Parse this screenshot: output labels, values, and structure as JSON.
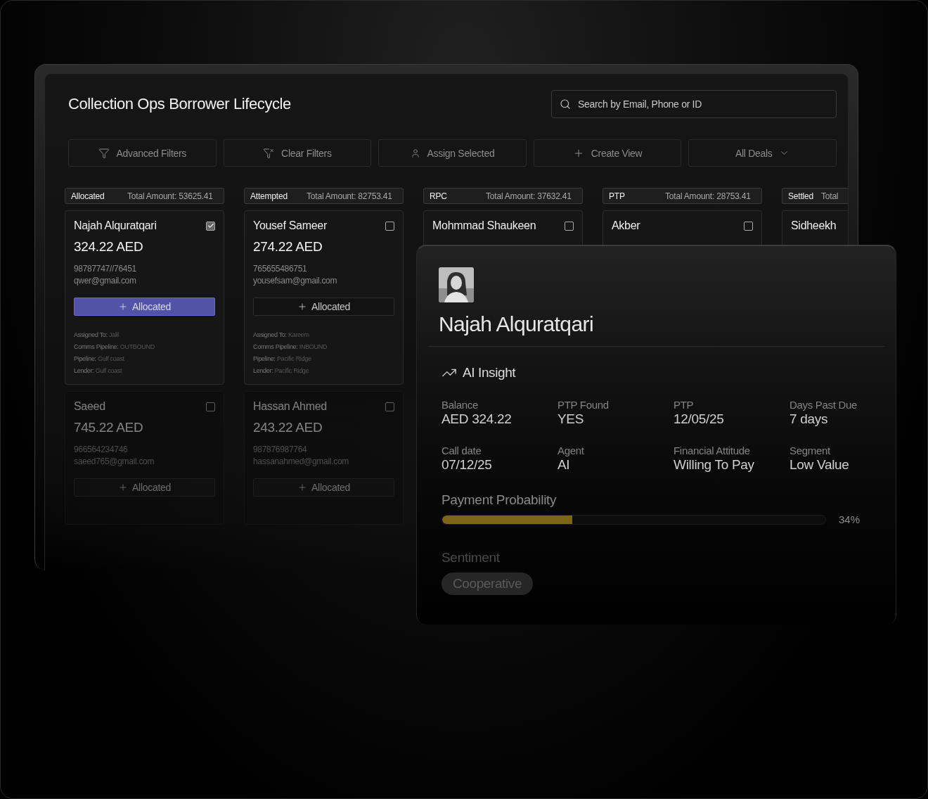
{
  "title": "Collection Ops Borrower Lifecycle",
  "search": {
    "placeholder": "Search by Email, Phone or ID"
  },
  "toolbar": [
    {
      "kind": "filter",
      "label": "Advanced Filters"
    },
    {
      "kind": "clear",
      "label": "Clear Filters"
    },
    {
      "kind": "user",
      "label": "Assign Selected"
    },
    {
      "kind": "plus",
      "label": "Create View"
    },
    {
      "kind": "dropdown",
      "label": "All Deals"
    }
  ],
  "columns": [
    {
      "status": "Allocated",
      "total": "Total Amount: 53625.41",
      "cards": [
        {
          "name": "Najah Alquratqari",
          "amount": "324.22 AED",
          "phone": "98787747//76451",
          "email": "qwer@gmail.com",
          "checked": true,
          "dimmed": false,
          "button": {
            "label": "Allocated",
            "selected": true
          },
          "details": [
            {
              "label": "Assigned To:",
              "value": "Jalil"
            },
            {
              "label": "Comms Pipeline:",
              "value": "OUTBOUND"
            },
            {
              "label": "Pipeline:",
              "value": "Gulf coast"
            },
            {
              "label": "Lender:",
              "value": "Gulf coast"
            }
          ]
        },
        {
          "name": "Saeed",
          "amount": "745.22 AED",
          "phone": "966564234746",
          "email": "saeed765@gmail.com",
          "checked": false,
          "dimmed": true,
          "button": {
            "label": "Allocated",
            "selected": false
          }
        }
      ]
    },
    {
      "status": "Attempted",
      "total": "Total Amount: 82753.41",
      "cards": [
        {
          "name": "Yousef Sameer",
          "amount": "274.22 AED",
          "phone": "765655486751",
          "email": "yousefsam@gmail.com",
          "checked": false,
          "dimmed": false,
          "button": {
            "label": "Allocated",
            "selected": false
          },
          "details": [
            {
              "label": "Assigned To:",
              "value": "Kareem"
            },
            {
              "label": "Comms Pipeline:",
              "value": "INBOUND"
            },
            {
              "label": "Pipeline:",
              "value": "Pacific Ridge"
            },
            {
              "label": "Lender:",
              "value": "Pacific Ridge"
            }
          ]
        },
        {
          "name": "Hassan Ahmed",
          "amount": "243.22 AED",
          "phone": "987876987764",
          "email": "hassanahmed@gmail.com",
          "checked": false,
          "dimmed": true,
          "button": {
            "label": "Allocated",
            "selected": false
          }
        }
      ]
    },
    {
      "status": "RPC",
      "total": "Total Amount: 37632.41",
      "cards": [
        {
          "name": "Mohmmad Shaukeen",
          "checked": false,
          "dimmed": false
        }
      ]
    },
    {
      "status": "PTP",
      "total": "Total Amount: 28753.41",
      "cards": [
        {
          "name": "Akber",
          "checked": false,
          "dimmed": false
        }
      ]
    },
    {
      "status": "Settled",
      "total": "Total",
      "cards": [
        {
          "name": "Sidheekh",
          "dimmed": false
        }
      ]
    }
  ],
  "profile": {
    "name": "Najah Alquratqari",
    "insight": "AI Insight",
    "fields": [
      {
        "label": "Balance",
        "value": "AED 324.22"
      },
      {
        "label": "PTP Found",
        "value": "YES"
      },
      {
        "label": "PTP",
        "value": "12/05/25"
      },
      {
        "label": "Days Past Due",
        "value": "7 days"
      },
      {
        "label": "Call date",
        "value": "07/12/25"
      },
      {
        "label": "Agent",
        "value": "AI"
      },
      {
        "label": "Financial Attitude",
        "value": "Willing To Pay"
      },
      {
        "label": "Segment",
        "value": "Low Value"
      }
    ],
    "probability": {
      "label": "Payment Probability",
      "level": 0.34,
      "reading": "34%"
    },
    "sentiment": {
      "label": "Sentiment",
      "value": "Cooperative"
    }
  }
}
